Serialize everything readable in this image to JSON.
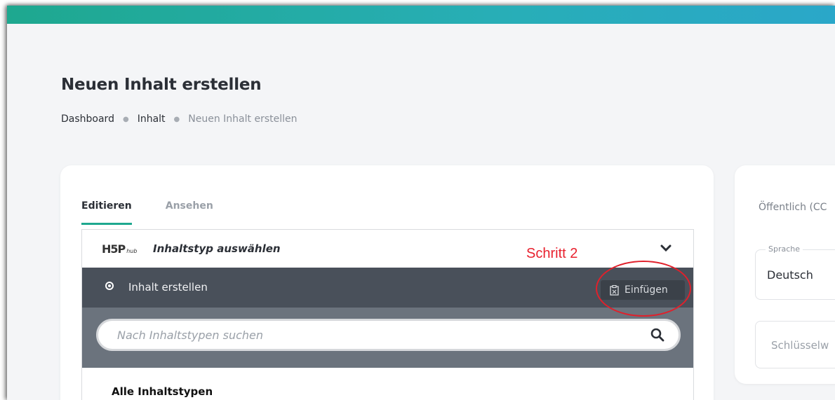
{
  "page": {
    "title": "Neuen Inhalt erstellen",
    "breadcrumb": [
      "Dashboard",
      "Inhalt",
      "Neuen Inhalt erstellen"
    ]
  },
  "tabs": [
    {
      "label": "Editieren",
      "active": true
    },
    {
      "label": "Ansehen",
      "active": false
    }
  ],
  "h5p": {
    "logo": "H5P",
    "logo_sub": "hub",
    "select_label": "Inhaltstyp auswählen",
    "create_label": "Inhalt erstellen",
    "paste_label": "Einfügen",
    "search_placeholder": "Nach Inhaltstypen suchen",
    "all_types_label": "Alle Inhaltstypen"
  },
  "annotation": {
    "label": "Schritt 2",
    "color": "#e8212e"
  },
  "sidebar": {
    "visibility_label": "Öffentlich (CC",
    "language_legend": "Sprache",
    "language_value": "Deutsch",
    "keywords_placeholder": "Schlüsselw"
  },
  "colors": {
    "accent": "#1ea88f",
    "topbar_end": "#2aa7c9",
    "create_bar": "#49505a",
    "search_zone": "#6b737d"
  }
}
